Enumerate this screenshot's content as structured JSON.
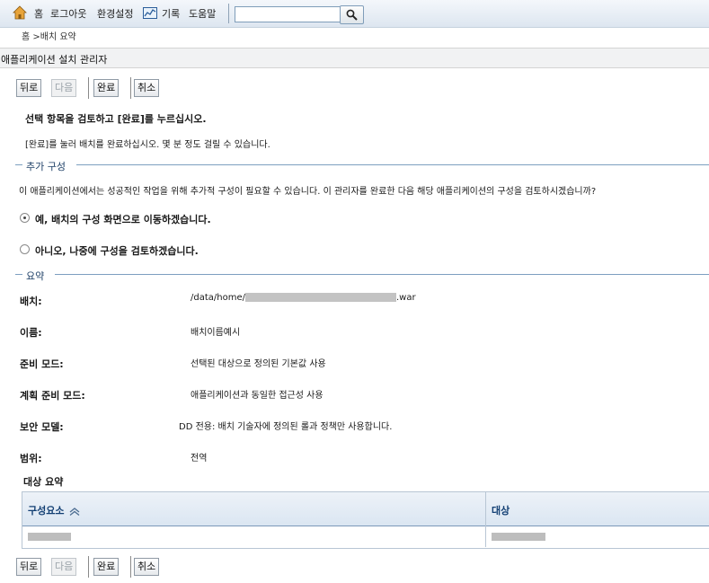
{
  "toolbar": {
    "home": "홈",
    "logout": "로그아웃",
    "preferences": "환경설정",
    "history": "기록",
    "help": "도움말",
    "search_value": ""
  },
  "breadcrumb": {
    "home": "홈",
    "current": " >배치 요약"
  },
  "page_title": "애플리케이션 설치 관리자",
  "buttons": {
    "back": "뒤로",
    "next": "다음",
    "finish": "완료",
    "cancel": "취소"
  },
  "instructions": {
    "main": "선택 항목을 검토하고 [완료]를 누르십시오.",
    "sub": "[완료]를 눌러 배치를 완료하십시오. 몇 분 정도 걸릴 수 있습니다."
  },
  "additional_config": {
    "title": "추가 구성",
    "description": "이 애플리케이션에서는 성공적인 작업을 위해 추가적 구성이 필요할 수 있습니다. 이 관리자를 완료한 다음 해당 애플리케이션의 구성을 검토하시겠습니까?",
    "option_yes": "예, 배치의 구성 화면으로 이동하겠습니다.",
    "option_no": "아니오, 나중에 구성을 검토하겠습니다.",
    "selected": "yes"
  },
  "summary": {
    "title": "요약",
    "rows": [
      {
        "label": "배치:",
        "value_prefix": "/data/home/",
        "value_suffix": ".war"
      },
      {
        "label": "이름:",
        "value": "배치이름예시"
      },
      {
        "label": "준비 모드:",
        "value": "선택된 대상으로 정의된 기본값 사용"
      },
      {
        "label": "계획 준비 모드:",
        "value": "애플리케이션과 동일한 접근성 사용"
      },
      {
        "label": "보안 모델:",
        "value": "DD 전용: 배치 기술자에 정의된 롤과 정책만 사용합니다."
      },
      {
        "label": "범위:",
        "value": "전역"
      }
    ]
  },
  "target_summary": {
    "title": "대상 요약",
    "columns": [
      "구성요소",
      "대상"
    ]
  }
}
